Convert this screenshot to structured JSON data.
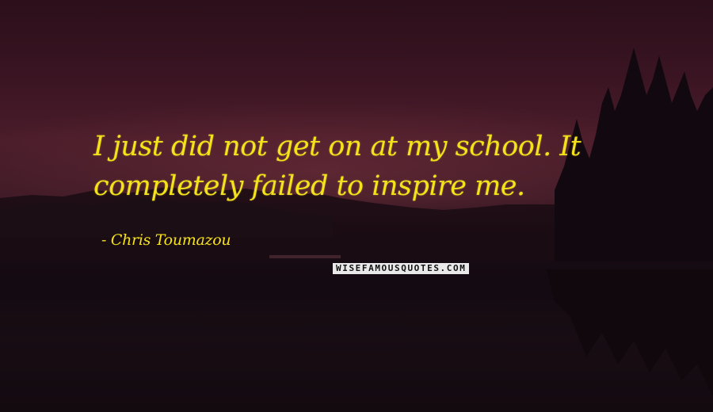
{
  "quote": {
    "text": "I just did not get on at my school. It\ncompletely failed to inspire me.",
    "author": "- Chris Toumazou"
  },
  "watermark": "WISEFAMOUSQUOTES.COM",
  "colors": {
    "text": "#f4e21a",
    "sky": "#3a1422",
    "water": "#150b12"
  }
}
